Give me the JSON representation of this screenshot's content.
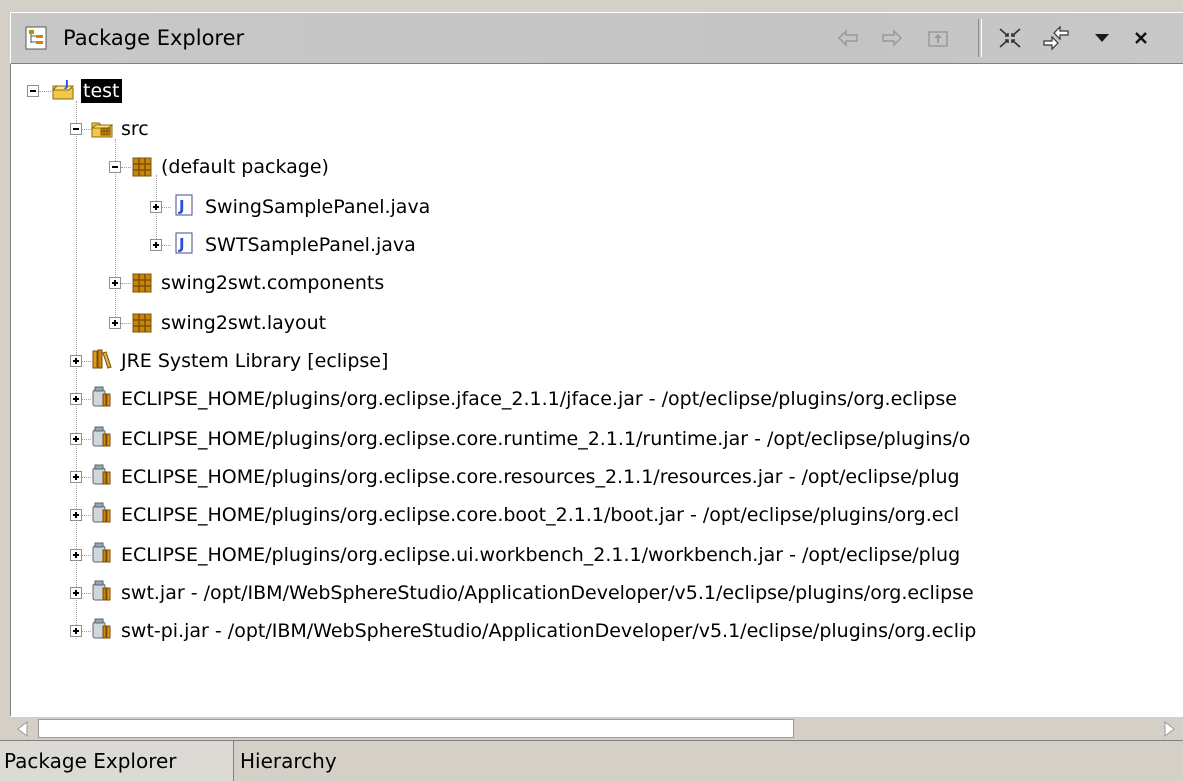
{
  "view": {
    "title": "Package Explorer",
    "toolbar": {
      "icons": [
        "back-arrow-icon",
        "forward-arrow-icon",
        "up-folder-icon",
        "collapse-all-icon",
        "link-with-editor-icon",
        "view-menu-icon",
        "close-icon"
      ]
    }
  },
  "tree": {
    "project": "test",
    "src": "src",
    "default_package": "(default package)",
    "file1": "SwingSamplePanel.java",
    "file2": "SWTSamplePanel.java",
    "pkg_components": "swing2swt.components",
    "pkg_layout": "swing2swt.layout",
    "jre": "JRE System Library [eclipse]",
    "jar1": "ECLIPSE_HOME/plugins/org.eclipse.jface_2.1.1/jface.jar - /opt/eclipse/plugins/org.eclipse",
    "jar2": "ECLIPSE_HOME/plugins/org.eclipse.core.runtime_2.1.1/runtime.jar - /opt/eclipse/plugins/o",
    "jar3": "ECLIPSE_HOME/plugins/org.eclipse.core.resources_2.1.1/resources.jar - /opt/eclipse/plug",
    "jar4": "ECLIPSE_HOME/plugins/org.eclipse.core.boot_2.1.1/boot.jar - /opt/eclipse/plugins/org.ecl",
    "jar5": "ECLIPSE_HOME/plugins/org.eclipse.ui.workbench_2.1.1/workbench.jar - /opt/eclipse/plug",
    "jar6": "swt.jar - /opt/IBM/WebSphereStudio/ApplicationDeveloper/v5.1/eclipse/plugins/org.eclipse",
    "jar7": "swt-pi.jar - /opt/IBM/WebSphereStudio/ApplicationDeveloper/v5.1/eclipse/plugins/org.eclip"
  },
  "tabs": {
    "package_explorer": "Package Explorer",
    "hierarchy": "Hierarchy"
  },
  "colors": {
    "chrome": "#d4d0c8",
    "selection_bg": "#000000",
    "selection_fg": "#ffffff",
    "package_icon": "#c9860a",
    "java_icon": "#2a4fd6"
  }
}
